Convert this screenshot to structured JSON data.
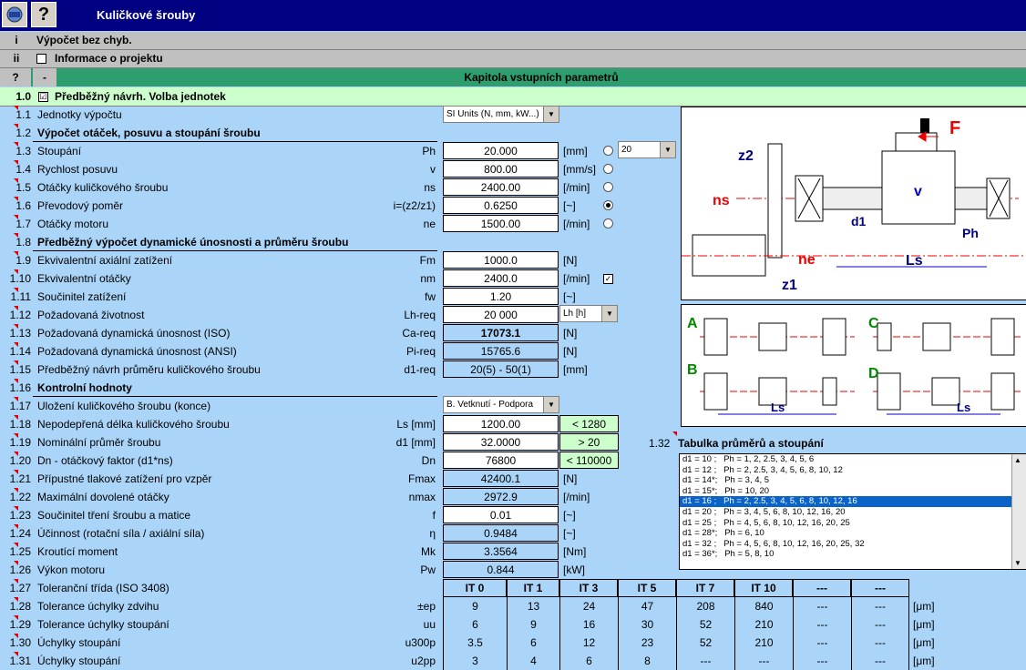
{
  "app": {
    "title": "Kuličkové šrouby",
    "help_label": "?"
  },
  "status": {
    "key": "i",
    "text": "Výpočet bez chyb."
  },
  "project": {
    "key": "ii",
    "text": "Informace o projektu"
  },
  "chapter": {
    "key": "?",
    "minus": "-",
    "text": "Kapitola vstupních parametrů"
  },
  "section1": {
    "num": "1.0",
    "text": "Předběžný návrh. Volba jednotek",
    "checked": "☑"
  },
  "rows": [
    {
      "num": "1.1",
      "label": "Jednotky výpočtu"
    },
    {
      "num": "1.2",
      "label": "Výpočet otáček, posuvu a stoupání šroubu"
    },
    {
      "num": "1.3",
      "label": "Stoupání",
      "sym": "Ph",
      "value": "20.000",
      "unit": "[mm]"
    },
    {
      "num": "1.4",
      "label": "Rychlost posuvu",
      "sym": "v",
      "value": "800.00",
      "unit": "[mm/s]"
    },
    {
      "num": "1.5",
      "label": "Otáčky kuličkového šroubu",
      "sym": "ns",
      "value": "2400.00",
      "unit": "[/min]"
    },
    {
      "num": "1.6",
      "label": "Převodový poměr",
      "sym": "i=(z2/z1)",
      "value": "0.6250",
      "unit": "[~]"
    },
    {
      "num": "1.7",
      "label": "Otáčky motoru",
      "sym": "ne",
      "value": "1500.00",
      "unit": "[/min]"
    },
    {
      "num": "1.8",
      "label": "Předběžný výpočet dynamické únosnosti a průměru šroubu"
    },
    {
      "num": "1.9",
      "label": "Ekvivalentní axiální zatížení",
      "sym": "Fm",
      "value": "1000.0",
      "unit": "[N]"
    },
    {
      "num": "1.10",
      "label": "Ekvivalentní otáčky",
      "sym": "nm",
      "value": "2400.0",
      "unit": "[/min]"
    },
    {
      "num": "1.11",
      "label": "Součinitel zatížení",
      "sym": "fw",
      "value": "1.20",
      "unit": "[~]"
    },
    {
      "num": "1.12",
      "label": "Požadovaná životnost",
      "sym": "Lh-req",
      "value": "20 000"
    },
    {
      "num": "1.13",
      "label": "Požadovaná dynamická únosnost (ISO)",
      "sym": "Ca-req",
      "value": "17073.1",
      "unit": "[N]"
    },
    {
      "num": "1.14",
      "label": "Požadovaná dynamická únosnost (ANSI)",
      "sym": "Pi-req",
      "value": "15765.6",
      "unit": "[N]"
    },
    {
      "num": "1.15",
      "label": "Předběžný návrh průměru kuličkového šroubu",
      "sym": "d1-req",
      "value": "20(5) - 50(1)",
      "unit": "[mm]"
    },
    {
      "num": "1.16",
      "label": "Kontrolní hodnoty"
    },
    {
      "num": "1.17",
      "label": "Uložení kuličkového šroubu (konce)"
    },
    {
      "num": "1.18",
      "label": "Nepodepřená délka kuličkového šroubu",
      "sym": "Ls [mm]",
      "value": "1200.00",
      "limit": "< 1280"
    },
    {
      "num": "1.19",
      "label": "Nominální průměr šroubu",
      "sym": "d1 [mm]",
      "value": "32.0000",
      "limit": "> 20"
    },
    {
      "num": "1.20",
      "label": "Dn - otáčkový faktor (d1*ns)",
      "sym": "Dn",
      "value": "76800",
      "limit": "< 110000"
    },
    {
      "num": "1.21",
      "label": "Přípustné tlakové zatížení pro vzpěr",
      "sym": "Fmax",
      "value": "42400.1",
      "unit": "[N]"
    },
    {
      "num": "1.22",
      "label": "Maximální dovolené otáčky",
      "sym": "nmax",
      "value": "2972.9",
      "unit": "[/min]"
    },
    {
      "num": "1.23",
      "label": "Součinitel tření šroubu a matice",
      "sym": "f",
      "value": "0.01",
      "unit": "[~]"
    },
    {
      "num": "1.24",
      "label": "Účinnost (rotační síla / axiální síla)",
      "sym": "η",
      "value": "0.9484",
      "unit": "[~]"
    },
    {
      "num": "1.25",
      "label": "Kroutící moment",
      "sym": "Mk",
      "value": "3.3564",
      "unit": "[Nm]"
    },
    {
      "num": "1.26",
      "label": "Výkon motoru",
      "sym": "Pw",
      "value": "0.844",
      "unit": "[kW]"
    },
    {
      "num": "1.27",
      "label": "Toleranční třída (ISO 3408)"
    },
    {
      "num": "1.28",
      "label": "Tolerance úchylky zdvihu",
      "sym": "±ep",
      "unit": "[μm]"
    },
    {
      "num": "1.29",
      "label": "Tolerance úchylky stoupání",
      "sym": "uu",
      "unit": "[μm]"
    },
    {
      "num": "1.30",
      "label": "Úchylky stoupání",
      "sym": "u300p",
      "unit": "[μm]"
    },
    {
      "num": "1.31",
      "label": "Úchylky stoupání",
      "sym": "u2pp",
      "unit": "[μm]"
    }
  ],
  "units_select": "SI Units (N, mm, kW...)",
  "pitch_select": "20",
  "life_select": "Lh [h]",
  "support_select": "B. Vetknutí - Podpora",
  "tolerance": {
    "headers": [
      "IT 0",
      "IT 1",
      "IT 3",
      "IT 5",
      "IT 7",
      "IT 10",
      "---",
      "---"
    ],
    "rows": [
      [
        "9",
        "13",
        "24",
        "47",
        "208",
        "840",
        "---",
        "---"
      ],
      [
        "6",
        "9",
        "16",
        "30",
        "52",
        "210",
        "---",
        "---"
      ],
      [
        "3.5",
        "6",
        "12",
        "23",
        "52",
        "210",
        "---",
        "---"
      ],
      [
        "3",
        "4",
        "6",
        "8",
        "---",
        "---",
        "---",
        "---"
      ]
    ]
  },
  "table_section": {
    "num": "1.32",
    "text": "Tabulka průměrů a stoupání"
  },
  "list": [
    "d1 = 10 ;   Ph = 1, 2, 2.5, 3, 4, 5, 6",
    "d1 = 12 ;   Ph = 2, 2.5, 3, 4, 5, 6, 8, 10, 12",
    "d1 = 14*;   Ph = 3, 4, 5",
    "d1 = 15*;   Ph = 10, 20",
    "d1 = 16 ;   Ph = 2, 2.5, 3, 4, 5, 6, 8, 10, 12, 16",
    "d1 = 20 ;   Ph = 3, 4, 5, 6, 8, 10, 12, 16, 20",
    "d1 = 25 ;   Ph = 4, 5, 6, 8, 10, 12, 16, 20, 25",
    "d1 = 28*;   Ph = 6, 10",
    "d1 = 32 ;   Ph = 4, 5, 6, 8, 10, 12, 16, 20, 25, 32",
    "d1 = 36*;   Ph = 5, 8, 10"
  ],
  "list_selected_index": 4,
  "diagram1": {
    "F": "F",
    "z2": "z2",
    "ns": "ns",
    "v": "v",
    "d1": "d1",
    "Ph": "Ph",
    "ne": "ne",
    "Ls": "Ls",
    "z1": "z1"
  },
  "diagram2": {
    "A": "A",
    "B": "B",
    "C": "C",
    "D": "D",
    "Ls": "Ls"
  },
  "colors": {
    "titlebar": "#000080",
    "background": "#aad4f8",
    "chapter": "#2e9e6e",
    "ok": "#ccffcc"
  }
}
